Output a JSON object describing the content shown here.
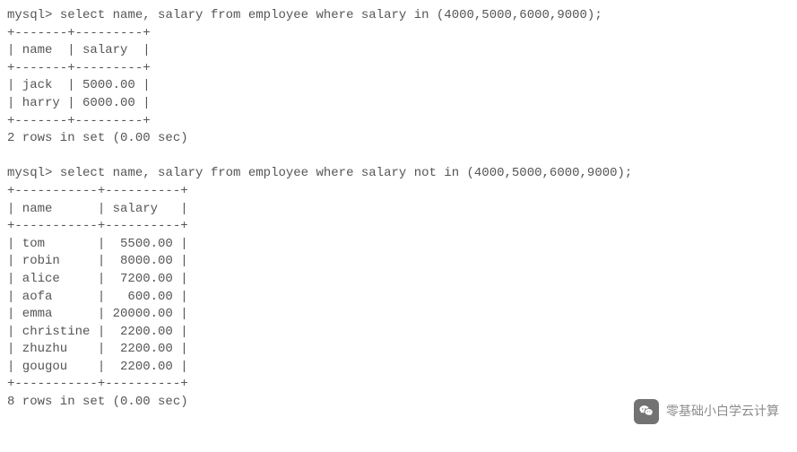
{
  "query1": {
    "prompt": "mysql>",
    "sql": "select name, salary from employee where salary in (4000,5000,6000,9000);",
    "border_top": "+-------+---------+",
    "header": "| name  | salary  |",
    "rows": [
      "| jack  | 5000.00 |",
      "| harry | 6000.00 |"
    ],
    "footer": "2 rows in set (0.00 sec)"
  },
  "query2": {
    "prompt": "mysql>",
    "sql": "select name, salary from employee where salary not in (4000,5000,6000,9000);",
    "border_top": "+-----------+----------+",
    "header": "| name      | salary   |",
    "rows": [
      "| tom       |  5500.00 |",
      "| robin     |  8000.00 |",
      "| alice     |  7200.00 |",
      "| aofa      |   600.00 |",
      "| emma      | 20000.00 |",
      "| christine |  2200.00 |",
      "| zhuzhu    |  2200.00 |",
      "| gougou    |  2200.00 |"
    ],
    "footer": "8 rows in set (0.00 sec)"
  },
  "watermark": {
    "text": "零基础小白学云计算"
  }
}
